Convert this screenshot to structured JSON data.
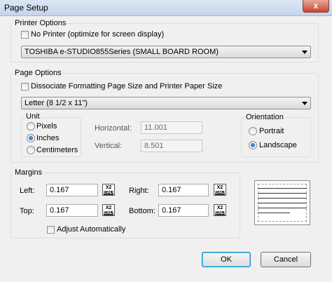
{
  "window": {
    "title": "Page Setup",
    "close_glyph": "x"
  },
  "printer_options": {
    "group_title": "Printer Options",
    "no_printer_label": "No Printer (optimize for screen display)",
    "no_printer_checked": false,
    "printer_selected": "TOSHIBA e-STUDIO855Series (SMALL BOARD ROOM)"
  },
  "page_options": {
    "group_title": "Page Options",
    "dissociate_label": "Dissociate Formatting Page Size and Printer Paper Size",
    "dissociate_checked": false,
    "paper_selected": "Letter (8 1/2 x 11\")",
    "unit": {
      "title": "Unit",
      "options": [
        "Pixels",
        "Inches",
        "Centimeters"
      ],
      "selected": "Inches"
    },
    "horizontal_label": "Horizontal:",
    "horizontal_value": "11.001",
    "vertical_label": "Vertical:",
    "vertical_value": "8.501",
    "orientation": {
      "title": "Orientation",
      "options": [
        "Portrait",
        "Landscape"
      ],
      "selected": "Landscape"
    }
  },
  "margins": {
    "group_title": "Margins",
    "left_label": "Left:",
    "left_value": "0.167",
    "right_label": "Right:",
    "right_value": "0.167",
    "top_label": "Top:",
    "top_value": "0.167",
    "bottom_label": "Bottom:",
    "bottom_value": "0.167",
    "calc_icon_top": "X2",
    "calc_icon_bottom": "CALC",
    "adjust_label": "Adjust Automatically",
    "adjust_checked": false
  },
  "buttons": {
    "ok": "OK",
    "cancel": "Cancel"
  }
}
